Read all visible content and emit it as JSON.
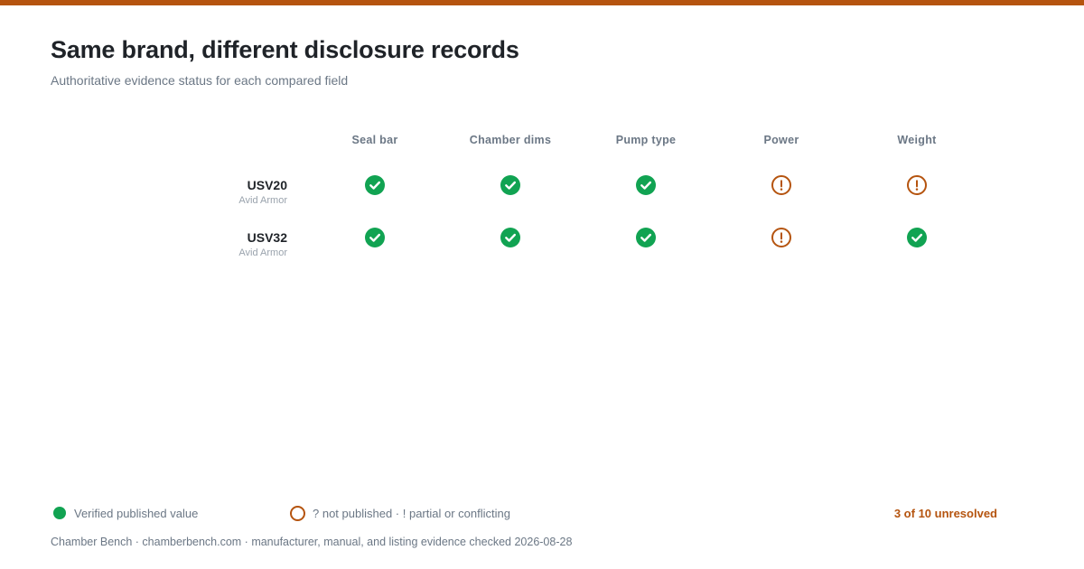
{
  "header": {
    "title": "Same brand, different disclosure records",
    "subtitle": "Authoritative evidence status for each compared field"
  },
  "columns": [
    "Seal bar",
    "Chamber dims",
    "Pump type",
    "Power",
    "Weight"
  ],
  "rows": [
    {
      "model": "USV20",
      "brand": "Avid Armor",
      "statuses": [
        "verified",
        "verified",
        "verified",
        "partial",
        "partial"
      ]
    },
    {
      "model": "USV32",
      "brand": "Avid Armor",
      "statuses": [
        "verified",
        "verified",
        "verified",
        "partial",
        "verified"
      ]
    }
  ],
  "legend": {
    "verified": "Verified published value",
    "unresolved": "? not published · ! partial or conflicting"
  },
  "summary": "3 of 10 unresolved",
  "footer": "Chamber Bench · chamberbench.com · manufacturer, manual, and listing evidence checked 2026-08-28",
  "colors": {
    "accent": "#b5540f",
    "verified": "#11a352",
    "muted_text": "#6b7785",
    "strong_text": "#1f2328"
  },
  "icons": {
    "verified": "check-circle-icon",
    "partial": "exclamation-ring-icon"
  }
}
